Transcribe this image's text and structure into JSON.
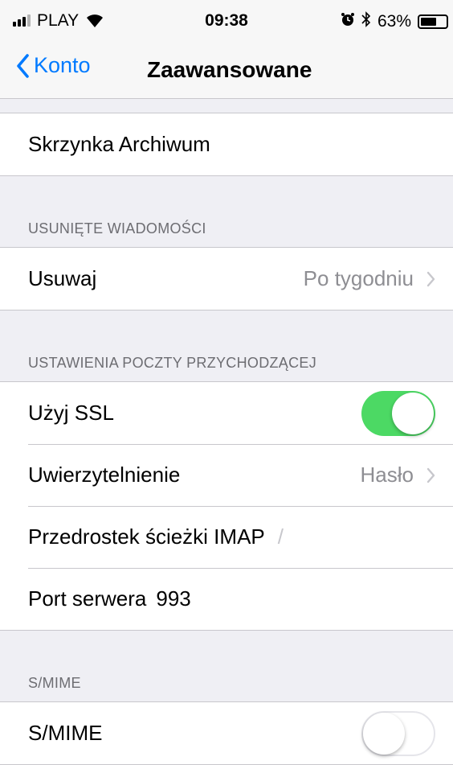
{
  "status_bar": {
    "carrier": "PLAY",
    "time": "09:38",
    "battery": "63%",
    "battery_level": 0.63,
    "icons": [
      "signal-icon",
      "wifi-icon",
      "alarm-icon",
      "bluetooth-icon",
      "battery-icon"
    ]
  },
  "nav": {
    "back_label": "Konto",
    "title": "Zaawansowane"
  },
  "archive": {
    "label": "Skrzynka Archiwum"
  },
  "deleted": {
    "header": "USUNIĘTE WIADOMOŚCI",
    "remove_label": "Usuwaj",
    "remove_value": "Po tygodniu"
  },
  "incoming": {
    "header": "USTAWIENIA POCZTY PRZYCHODZĄCEJ",
    "ssl_label": "Użyj SSL",
    "ssl_on": true,
    "auth_label": "Uwierzytelnienie",
    "auth_value": "Hasło",
    "imap_label": "Przedrostek ścieżki IMAP",
    "imap_value": "/",
    "port_label": "Port serwera",
    "port_value": "993"
  },
  "smime": {
    "header": "S/MIME",
    "label": "S/MIME",
    "on": false
  },
  "colors": {
    "accent": "#007aff",
    "toggle_on": "#4cd964",
    "background": "#efeff4"
  }
}
